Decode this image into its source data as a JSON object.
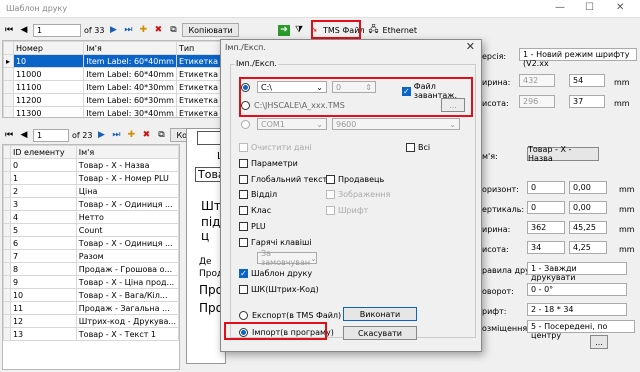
{
  "window": {
    "title": "Шаблон друку",
    "minimize": "—",
    "maximize": "☐",
    "close": "✕"
  },
  "toolbar1": {
    "page": "1",
    "of": "of 33",
    "copy_label": "Копіювати",
    "tms_label": "TMS Файл",
    "ethernet_label": "Ethernet"
  },
  "top_grid": {
    "headers": [
      "Номер",
      "Ім'я",
      "Тип"
    ],
    "rows": [
      [
        "10",
        "Item Label: 60*40mm",
        "Етикетка"
      ],
      [
        "11000",
        "Item Label: 60*40mm",
        "Етикетка"
      ],
      [
        "11100",
        "Item Label: 40*30mm",
        "Етикетка"
      ],
      [
        "11200",
        "Item Label: 60*30mm",
        "Етикетка"
      ],
      [
        "11300",
        "Item Label: 30*40mm",
        "Етикетка"
      ]
    ]
  },
  "toolbar2": {
    "page": "1",
    "of": "of 23",
    "copy_label": "Копіювати"
  },
  "bottom_grid": {
    "headers": [
      "ID елементу",
      "Ім'я"
    ],
    "rows": [
      [
        "0",
        "Товар - X - Назва"
      ],
      [
        "1",
        "Товар - X - Номер PLU"
      ],
      [
        "2",
        "Ціна"
      ],
      [
        "3",
        "Товар - X - Одиниця ..."
      ],
      [
        "4",
        "Нетто"
      ],
      [
        "5",
        "Count"
      ],
      [
        "6",
        "Товар - X - Одиниця ..."
      ],
      [
        "7",
        "Разом"
      ],
      [
        "8",
        "Продаж - Грошова о..."
      ],
      [
        "9",
        "Товар - X - Ціна прод..."
      ],
      [
        "10",
        "Товар - X - Вага/Кіл..."
      ],
      [
        "11",
        "Продаж - Загальна ..."
      ],
      [
        "12",
        "Штрих-код - Друкува..."
      ],
      [
        "13",
        "Товар - X - Текст 1"
      ]
    ]
  },
  "preview": {
    "t1": "Ц",
    "t2": "Това",
    "t3": "Штр",
    "t4": "під ц",
    "t5": "Де",
    "t6": "Прод",
    "t7": "Прод",
    "t8": "Про"
  },
  "right_panel": {
    "version_label": "ерсія:",
    "version_value": "1 - Новий режим шрифту (V2.xx",
    "width_label": "ирина:",
    "width_px": "432",
    "width_mm": "54",
    "height_label": "исота:",
    "height_px": "296",
    "height_mm": "37",
    "unit": "mm",
    "field_label": "м'я:",
    "field_button": "Товар - X - Назва",
    "horiz_label": "оризонт:",
    "horiz_a": "0",
    "horiz_b": "0,00",
    "vert_label": "ертикаль:",
    "vert_a": "0",
    "vert_b": "0,00",
    "w2_label": "ирина:",
    "w2_a": "362",
    "w2_b": "45,25",
    "h2_label": "исота:",
    "h2_a": "34",
    "h2_b": "4,25",
    "print_rule_label": "равила друку:",
    "print_rule_value": "1 - Завжди друкувати",
    "rotate_label": "оворот:",
    "rotate_value": "0 - 0°",
    "font_label": "рифт:",
    "font_value": "2 - 18 * 34",
    "placement_label": "озміщення:",
    "placement_value": "5 - Посередені, по центру",
    "more_button": "..."
  },
  "dialog": {
    "title": "Імп./Експ.",
    "close": "✕",
    "group_label": "Імп./Експ.",
    "drive_value": "C:\\",
    "num_value": "0",
    "load_file_label": "Файл завантаж.",
    "path_value": "C:\\JHSCALE\\A_xxx.TMS",
    "browse_button": "...",
    "com_value": "COM1",
    "baud_value": "9600",
    "clear_data": "Очистити дані",
    "all_label": "Всі",
    "params": "Параметри",
    "global_text": "Глобальний текст",
    "seller": "Продавець",
    "department": "Відділ",
    "images": "Зображення",
    "class": "Клас",
    "font": "Шрифт",
    "plu": "PLU",
    "hotkeys": "Гарячі клавіші",
    "default_value": "За замовчуван",
    "print_template": "Шаблон друку",
    "barcode": "ШК(Штрих-Код)",
    "export_label": "Експорт(в TMS Файл)",
    "import_label": "Імпорт(в програму)",
    "execute_button": "Виконати",
    "cancel_button": "Скасувати"
  },
  "colors": {
    "selection": "#0a64c8",
    "highlight": "#e0101a"
  }
}
